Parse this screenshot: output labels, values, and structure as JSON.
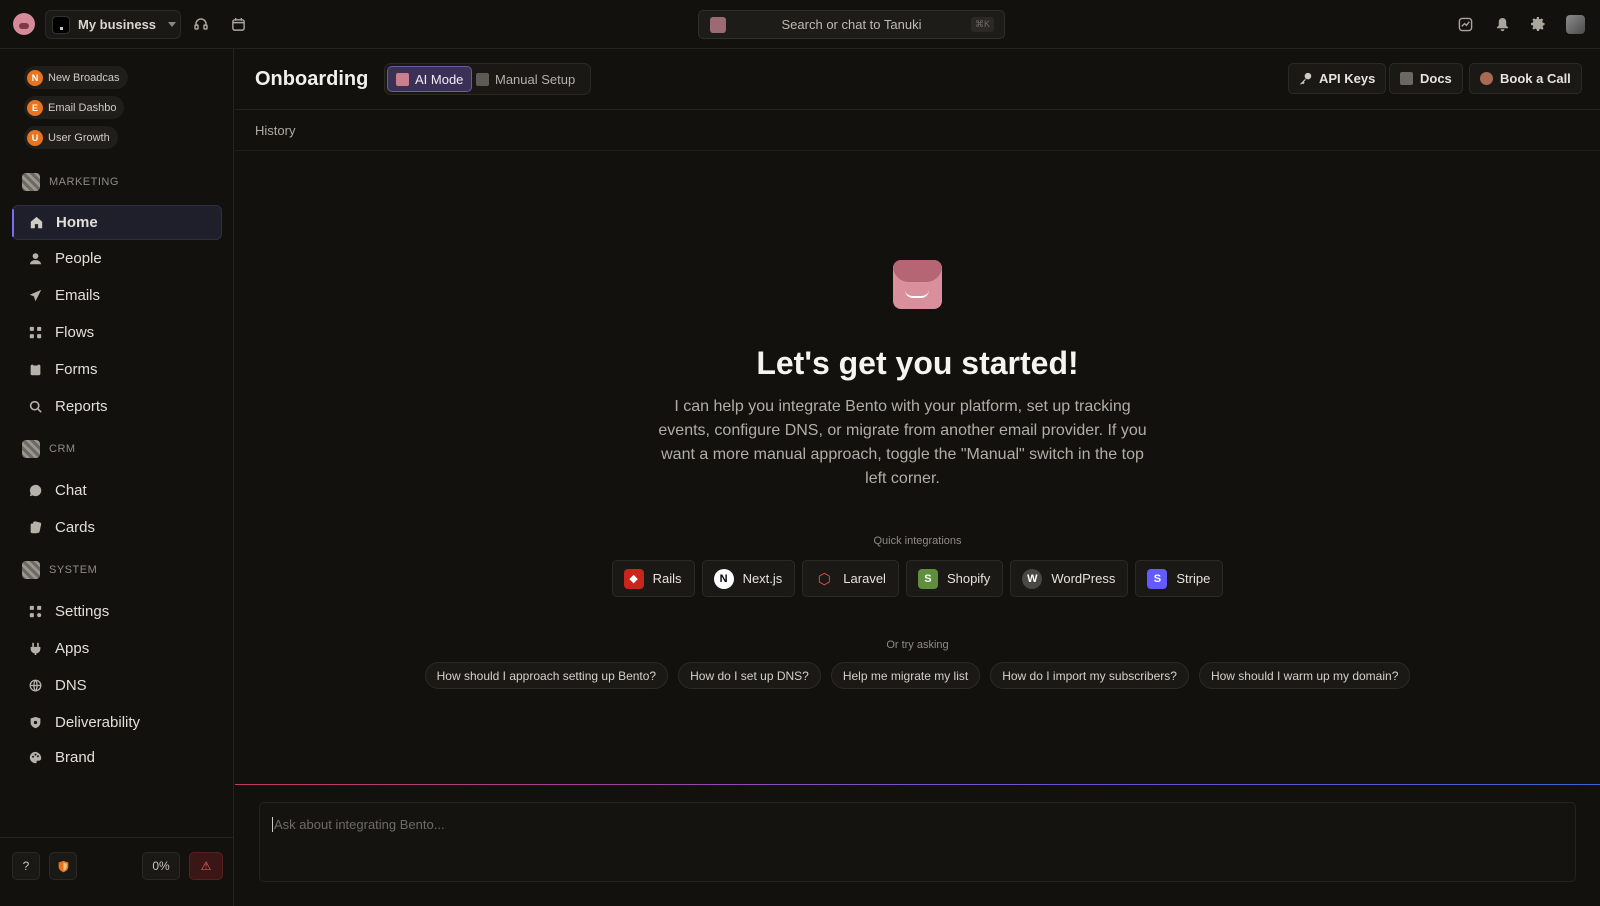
{
  "topbar": {
    "business_name": "My business",
    "search_placeholder": "Search or chat to Tanuki",
    "search_shortcut": "⌘K"
  },
  "sidebar": {
    "recent": [
      {
        "initial": "N",
        "label": "New Broadcas"
      },
      {
        "initial": "E",
        "label": "Email Dashbo"
      },
      {
        "initial": "U",
        "label": "User Growth"
      }
    ],
    "sections": {
      "marketing": "MARKETING",
      "crm": "CRM",
      "system": "SYSTEM"
    },
    "marketing_items": [
      {
        "label": "Home",
        "icon": "home-icon",
        "active": true
      },
      {
        "label": "People",
        "icon": "person-icon"
      },
      {
        "label": "Emails",
        "icon": "send-icon"
      },
      {
        "label": "Flows",
        "icon": "flow-icon"
      },
      {
        "label": "Forms",
        "icon": "clipboard-icon"
      },
      {
        "label": "Reports",
        "icon": "magnifier-icon"
      }
    ],
    "crm_items": [
      {
        "label": "Chat",
        "icon": "chat-icon"
      },
      {
        "label": "Cards",
        "icon": "cards-icon"
      }
    ],
    "system_items": [
      {
        "label": "Settings",
        "icon": "settings-icon"
      },
      {
        "label": "Apps",
        "icon": "plug-icon"
      },
      {
        "label": "DNS",
        "icon": "globe-icon"
      },
      {
        "label": "Deliverability",
        "icon": "shield-icon"
      },
      {
        "label": "Brand",
        "icon": "palette-icon"
      }
    ],
    "bottom": {
      "help": "?",
      "progress": "0%",
      "warning": "⚠"
    }
  },
  "main": {
    "title": "Onboarding",
    "modes": [
      {
        "label": "AI Mode",
        "active": true
      },
      {
        "label": "Manual Setup",
        "active": false
      }
    ],
    "header_buttons": {
      "api_keys": "API Keys",
      "docs": "Docs",
      "book_call": "Book a Call"
    },
    "history": "History",
    "hero_title": "Let's get you started!",
    "hero_desc": "I can help you integrate Bento with your platform, set up tracking events, configure DNS, or migrate from another email provider. If you want a more manual approach, toggle the \"Manual\" switch in the top left corner.",
    "quick_label": "Quick integrations",
    "integrations": [
      "Rails",
      "Next.js",
      "Laravel",
      "Shopify",
      "WordPress",
      "Stripe"
    ],
    "try_label": "Or try asking",
    "suggestions": [
      "How should I approach setting up Bento?",
      "How do I set up DNS?",
      "Help me migrate my list",
      "How do I import my subscribers?",
      "How should I warm up my domain?"
    ],
    "composer_placeholder": "Ask about integrating Bento..."
  },
  "colors": {
    "accent": "#7a6cf0",
    "pill_orange": "#e8741f",
    "ai_mode_bg": "#3b3157"
  }
}
